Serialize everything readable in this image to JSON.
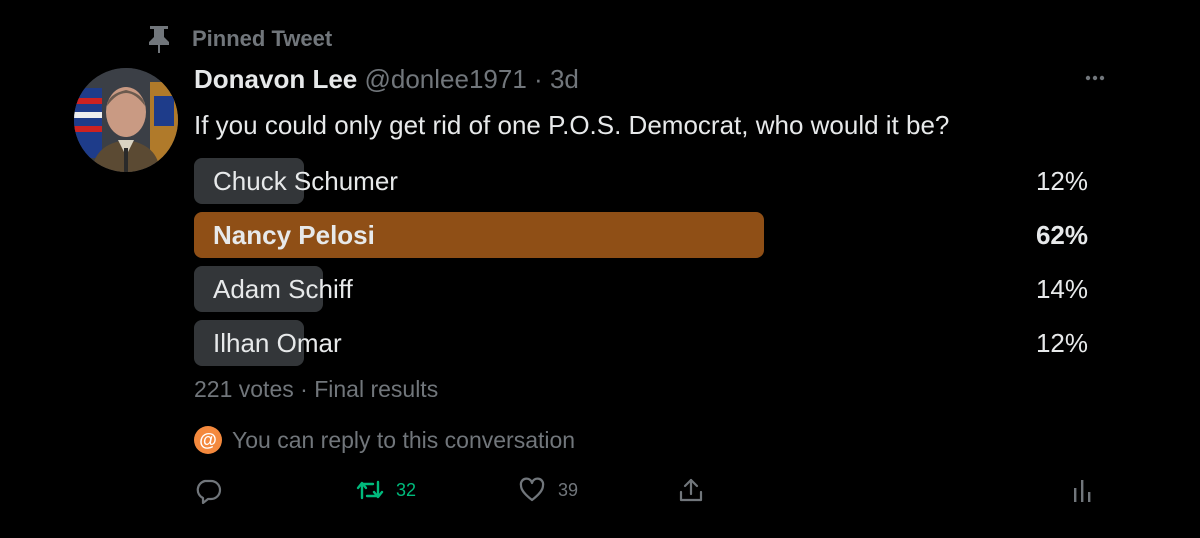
{
  "pinned_label": "Pinned Tweet",
  "author": {
    "display_name": "Donavon Lee",
    "handle": "@donlee1971",
    "separator": "·",
    "time": "3d"
  },
  "tweet_text": "If you could only get rid of one P.O.S. Democrat, who would it be?",
  "poll": {
    "options": [
      {
        "label": "Chuck Schumer",
        "percent": "12%",
        "fraction": 0.12,
        "winner": false
      },
      {
        "label": "Nancy Pelosi",
        "percent": "62%",
        "fraction": 0.62,
        "winner": true
      },
      {
        "label": "Adam Schiff",
        "percent": "14%",
        "fraction": 0.14,
        "winner": false
      },
      {
        "label": "Ilhan Omar",
        "percent": "12%",
        "fraction": 0.12,
        "winner": false
      }
    ],
    "votes": "221 votes",
    "separator": "·",
    "status": "Final results"
  },
  "reply_note": {
    "icon": "at-icon",
    "text": "You can reply to this conversation"
  },
  "actions": {
    "reply": {
      "icon": "reply-icon"
    },
    "retweet": {
      "icon": "retweet-icon",
      "count": "32",
      "color": "#00ba7c"
    },
    "like": {
      "icon": "heart-icon",
      "count": "39"
    },
    "share": {
      "icon": "share-icon"
    },
    "analytics": {
      "icon": "analytics-icon"
    }
  },
  "colors": {
    "background": "#000000",
    "winner_bar": "#8f4f16",
    "bar": "#333639",
    "secondary_text": "#71767b",
    "retweet_green": "#00ba7c",
    "reply_badge": "#f4893d"
  }
}
